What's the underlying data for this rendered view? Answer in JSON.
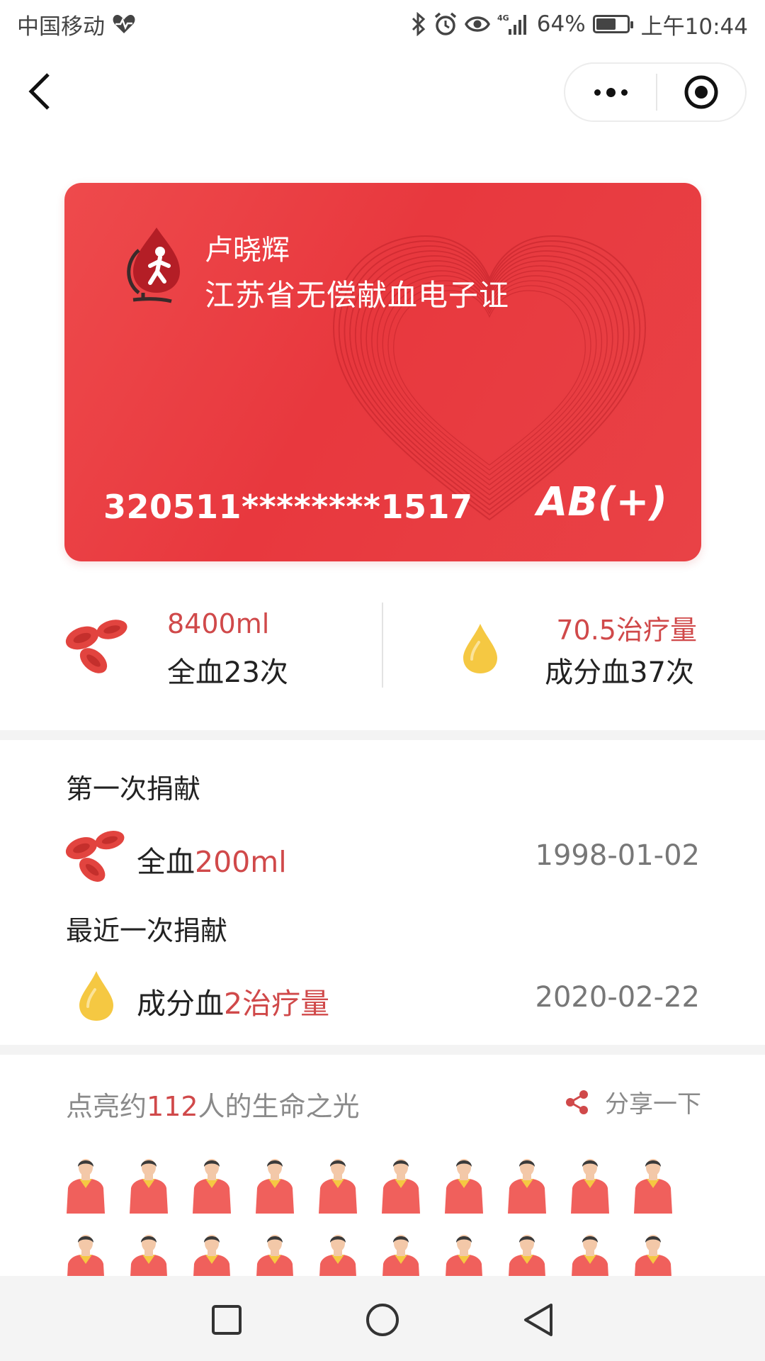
{
  "status_bar": {
    "carrier": "中国移动",
    "battery_percent": "64%",
    "battery_level": 0.64,
    "time": "上午10:44",
    "icons": [
      "heart-pulse-icon",
      "bluetooth-icon",
      "alarm-icon",
      "eye-icon",
      "signal-4g-icon",
      "battery-icon"
    ]
  },
  "nav": {
    "back_icon": "chevron-left-icon",
    "more_icon": "more-dots-icon",
    "close_icon": "target-close-icon"
  },
  "card": {
    "name": "卢晓辉",
    "title": "江苏省无偿献血电子证",
    "id_number": "320511********1517",
    "blood_type": "AB(+)",
    "background_color": "#e8383e"
  },
  "stats": {
    "whole_blood": {
      "amount": "8400ml",
      "count_label": "全血23次",
      "icon": "red-blood-cells-icon"
    },
    "component_blood": {
      "amount": "70.5治疗量",
      "count_label": "成分血37次",
      "icon": "yellow-drop-icon"
    }
  },
  "history": {
    "first": {
      "label": "第一次捐献",
      "type": "全血",
      "amount": "200ml",
      "date": "1998-01-02",
      "icon": "red-blood-cells-icon"
    },
    "latest": {
      "label": "最近一次捐献",
      "type": "成分血",
      "amount": "2治疗量",
      "date": "2020-02-22",
      "icon": "yellow-drop-icon"
    }
  },
  "lives": {
    "title_prefix": "点亮约",
    "count": "112",
    "title_suffix": "人的生命之光",
    "share_label": "分享一下",
    "share_icon": "share-icon",
    "person_icon": "person-icon",
    "people_rows_visible": 2,
    "people_per_row": 10
  },
  "android_nav": {
    "icons": [
      "square-recents-icon",
      "circle-home-icon",
      "triangle-back-icon"
    ]
  },
  "colors": {
    "accent": "#d0494a",
    "card_red": "#e8383e",
    "drop_yellow": "#f5c842"
  }
}
